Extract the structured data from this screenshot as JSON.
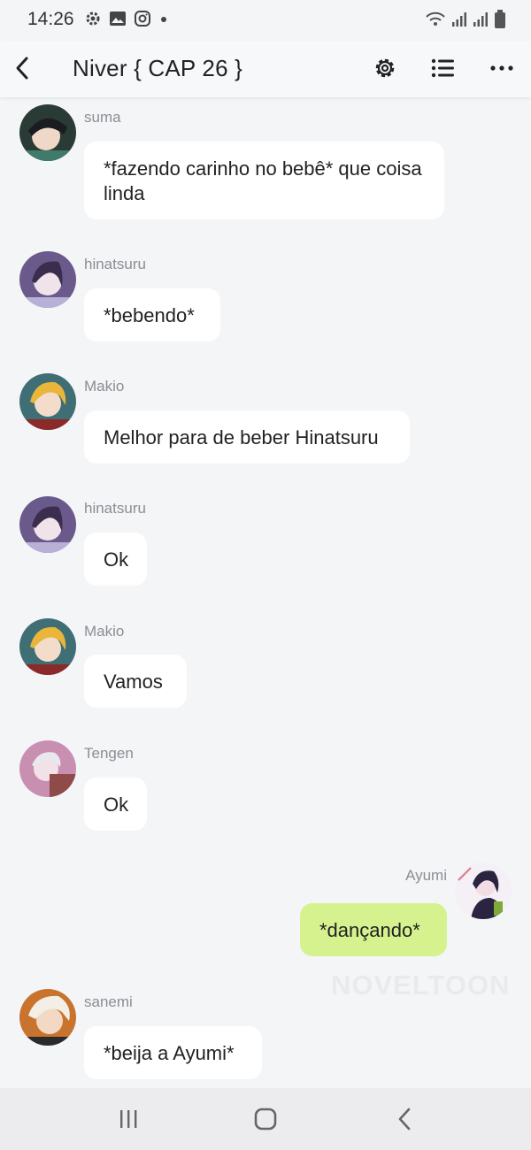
{
  "status_bar": {
    "time": "14:26",
    "icons": [
      "gear-icon",
      "image-icon",
      "instagram-icon",
      "dot-icon",
      "wifi-icon",
      "signal-icon",
      "signal-icon",
      "battery-icon"
    ]
  },
  "header": {
    "back_icon": "chevron-left-icon",
    "title": "Niver { CAP 26 }",
    "actions": [
      "settings-icon",
      "list-icon",
      "more-icon"
    ]
  },
  "messages": [
    {
      "user": "suma",
      "text": "*fazendo carinho no bebê* que coisa linda",
      "side": "left",
      "avatar_color": "#2a3a35"
    },
    {
      "user": "hinatsuru",
      "text": "*bebendo*",
      "side": "left",
      "avatar_color": "#6a5a8c"
    },
    {
      "user": "Makio",
      "text": "Melhor para de beber Hinatsuru",
      "side": "left",
      "avatar_color": "#3f6e74"
    },
    {
      "user": "hinatsuru",
      "text": "Ok",
      "side": "left",
      "avatar_color": "#6a5a8c"
    },
    {
      "user": "Makio",
      "text": "Vamos",
      "side": "left",
      "avatar_color": "#3f6e74"
    },
    {
      "user": "Tengen",
      "text": "Ok",
      "side": "left",
      "avatar_color": "#c98fb0"
    },
    {
      "user": "Ayumi",
      "text": "*dançando*",
      "side": "right",
      "avatar_color": "#2b2440"
    },
    {
      "user": "sanemi",
      "text": "*beija a Ayumi*",
      "side": "left",
      "avatar_color": "#c8732e"
    }
  ],
  "watermark": "NOVELTOON",
  "colors": {
    "background": "#f4f5f7",
    "bubble": "#ffffff",
    "own_bubble": "#d6f28f",
    "username": "#8a8e94"
  },
  "nav_bar": [
    "recent-apps-icon",
    "home-icon",
    "back-icon"
  ]
}
